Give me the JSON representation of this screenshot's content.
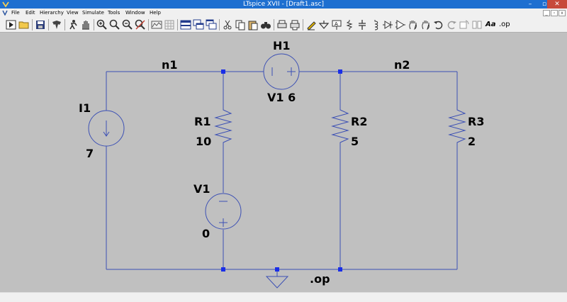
{
  "window": {
    "title": "LTspice XVII - [Draft1.asc]",
    "minimize": "–",
    "maximize": "▫",
    "close": "✕"
  },
  "menu": [
    "File",
    "Edit",
    "Hierarchy",
    "View",
    "Simulate",
    "Tools",
    "Window",
    "Help"
  ],
  "toolbar": {
    "font_label": "Aa",
    "op_label": ".op"
  },
  "colors": {
    "wire": "#3c50b4",
    "junction": "#1a2ee8",
    "canvas": "#c0c0c0"
  },
  "schematic": {
    "nets": {
      "n1": "n1",
      "n2": "n2"
    },
    "I1": {
      "name": "I1",
      "value": "7"
    },
    "H1": {
      "name": "H1",
      "value": "V1 6"
    },
    "R1": {
      "name": "R1",
      "value": "10"
    },
    "R2": {
      "name": "R2",
      "value": "5"
    },
    "R3": {
      "name": "R3",
      "value": "2"
    },
    "V1": {
      "name": "V1",
      "value": "0"
    },
    "directive": ".op"
  }
}
